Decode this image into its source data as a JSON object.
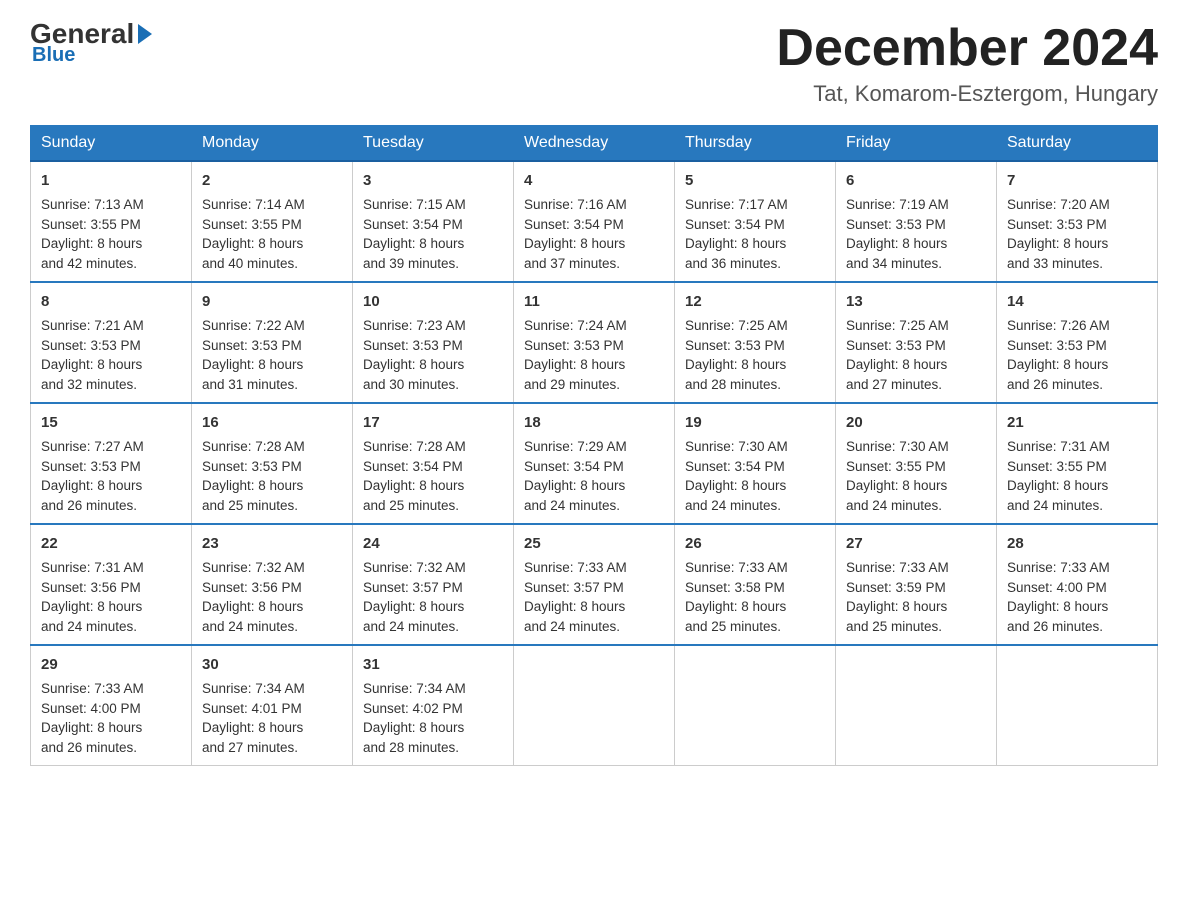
{
  "logo": {
    "general": "General",
    "blue": "Blue"
  },
  "header": {
    "month_title": "December 2024",
    "location": "Tat, Komarom-Esztergom, Hungary"
  },
  "weekdays": [
    "Sunday",
    "Monday",
    "Tuesday",
    "Wednesday",
    "Thursday",
    "Friday",
    "Saturday"
  ],
  "weeks": [
    [
      {
        "day": "1",
        "sunrise": "7:13 AM",
        "sunset": "3:55 PM",
        "daylight": "8 hours and 42 minutes."
      },
      {
        "day": "2",
        "sunrise": "7:14 AM",
        "sunset": "3:55 PM",
        "daylight": "8 hours and 40 minutes."
      },
      {
        "day": "3",
        "sunrise": "7:15 AM",
        "sunset": "3:54 PM",
        "daylight": "8 hours and 39 minutes."
      },
      {
        "day": "4",
        "sunrise": "7:16 AM",
        "sunset": "3:54 PM",
        "daylight": "8 hours and 37 minutes."
      },
      {
        "day": "5",
        "sunrise": "7:17 AM",
        "sunset": "3:54 PM",
        "daylight": "8 hours and 36 minutes."
      },
      {
        "day": "6",
        "sunrise": "7:19 AM",
        "sunset": "3:53 PM",
        "daylight": "8 hours and 34 minutes."
      },
      {
        "day": "7",
        "sunrise": "7:20 AM",
        "sunset": "3:53 PM",
        "daylight": "8 hours and 33 minutes."
      }
    ],
    [
      {
        "day": "8",
        "sunrise": "7:21 AM",
        "sunset": "3:53 PM",
        "daylight": "8 hours and 32 minutes."
      },
      {
        "day": "9",
        "sunrise": "7:22 AM",
        "sunset": "3:53 PM",
        "daylight": "8 hours and 31 minutes."
      },
      {
        "day": "10",
        "sunrise": "7:23 AM",
        "sunset": "3:53 PM",
        "daylight": "8 hours and 30 minutes."
      },
      {
        "day": "11",
        "sunrise": "7:24 AM",
        "sunset": "3:53 PM",
        "daylight": "8 hours and 29 minutes."
      },
      {
        "day": "12",
        "sunrise": "7:25 AM",
        "sunset": "3:53 PM",
        "daylight": "8 hours and 28 minutes."
      },
      {
        "day": "13",
        "sunrise": "7:25 AM",
        "sunset": "3:53 PM",
        "daylight": "8 hours and 27 minutes."
      },
      {
        "day": "14",
        "sunrise": "7:26 AM",
        "sunset": "3:53 PM",
        "daylight": "8 hours and 26 minutes."
      }
    ],
    [
      {
        "day": "15",
        "sunrise": "7:27 AM",
        "sunset": "3:53 PM",
        "daylight": "8 hours and 26 minutes."
      },
      {
        "day": "16",
        "sunrise": "7:28 AM",
        "sunset": "3:53 PM",
        "daylight": "8 hours and 25 minutes."
      },
      {
        "day": "17",
        "sunrise": "7:28 AM",
        "sunset": "3:54 PM",
        "daylight": "8 hours and 25 minutes."
      },
      {
        "day": "18",
        "sunrise": "7:29 AM",
        "sunset": "3:54 PM",
        "daylight": "8 hours and 24 minutes."
      },
      {
        "day": "19",
        "sunrise": "7:30 AM",
        "sunset": "3:54 PM",
        "daylight": "8 hours and 24 minutes."
      },
      {
        "day": "20",
        "sunrise": "7:30 AM",
        "sunset": "3:55 PM",
        "daylight": "8 hours and 24 minutes."
      },
      {
        "day": "21",
        "sunrise": "7:31 AM",
        "sunset": "3:55 PM",
        "daylight": "8 hours and 24 minutes."
      }
    ],
    [
      {
        "day": "22",
        "sunrise": "7:31 AM",
        "sunset": "3:56 PM",
        "daylight": "8 hours and 24 minutes."
      },
      {
        "day": "23",
        "sunrise": "7:32 AM",
        "sunset": "3:56 PM",
        "daylight": "8 hours and 24 minutes."
      },
      {
        "day": "24",
        "sunrise": "7:32 AM",
        "sunset": "3:57 PM",
        "daylight": "8 hours and 24 minutes."
      },
      {
        "day": "25",
        "sunrise": "7:33 AM",
        "sunset": "3:57 PM",
        "daylight": "8 hours and 24 minutes."
      },
      {
        "day": "26",
        "sunrise": "7:33 AM",
        "sunset": "3:58 PM",
        "daylight": "8 hours and 25 minutes."
      },
      {
        "day": "27",
        "sunrise": "7:33 AM",
        "sunset": "3:59 PM",
        "daylight": "8 hours and 25 minutes."
      },
      {
        "day": "28",
        "sunrise": "7:33 AM",
        "sunset": "4:00 PM",
        "daylight": "8 hours and 26 minutes."
      }
    ],
    [
      {
        "day": "29",
        "sunrise": "7:33 AM",
        "sunset": "4:00 PM",
        "daylight": "8 hours and 26 minutes."
      },
      {
        "day": "30",
        "sunrise": "7:34 AM",
        "sunset": "4:01 PM",
        "daylight": "8 hours and 27 minutes."
      },
      {
        "day": "31",
        "sunrise": "7:34 AM",
        "sunset": "4:02 PM",
        "daylight": "8 hours and 28 minutes."
      },
      null,
      null,
      null,
      null
    ]
  ],
  "labels": {
    "sunrise": "Sunrise:",
    "sunset": "Sunset:",
    "daylight": "Daylight:"
  }
}
